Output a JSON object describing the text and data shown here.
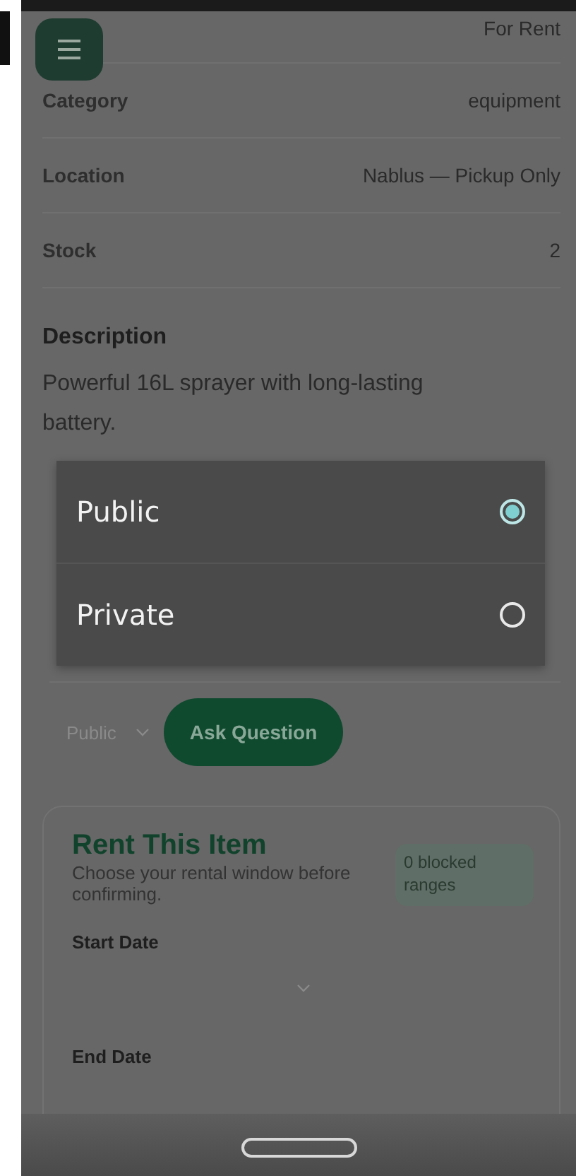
{
  "details": [
    {
      "value": "For Rent"
    },
    {
      "label": "Category",
      "value": "equipment"
    },
    {
      "label": "Location",
      "value": "Nablus — Pickup Only"
    },
    {
      "label": "Stock",
      "value": "2"
    }
  ],
  "description": {
    "heading": "Description",
    "text": "Powerful 16L sprayer with long-lasting battery."
  },
  "visibility_menu": {
    "options": [
      {
        "label": "Public",
        "selected": true
      },
      {
        "label": "Private",
        "selected": false
      }
    ]
  },
  "question_form": {
    "visibility": "Public",
    "ask_button": "Ask Question"
  },
  "rent_card": {
    "title": "Rent This Item",
    "subtitle": "Choose your rental window before confirming.",
    "badge": "0 blocked ranges",
    "start_label": "Start Date",
    "end_label": "End Date"
  }
}
